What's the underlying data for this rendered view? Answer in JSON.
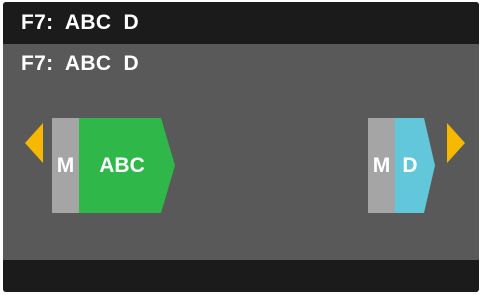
{
  "header": {
    "title": "F7:  ABC  D"
  },
  "subtitle": "F7:  ABC  D",
  "blocks": {
    "left_m": "M",
    "abc": "ABC",
    "right_m": "M",
    "d": "D"
  },
  "colors": {
    "accent": "#f6b800",
    "abc_fill": "#30b74a",
    "d_fill": "#63c7db",
    "m_fill": "#a5a5a5",
    "background": "#595959",
    "bar": "#1b1b1b"
  },
  "icons": {
    "left_arrow": "triangle-left",
    "right_arrow": "triangle-right"
  }
}
